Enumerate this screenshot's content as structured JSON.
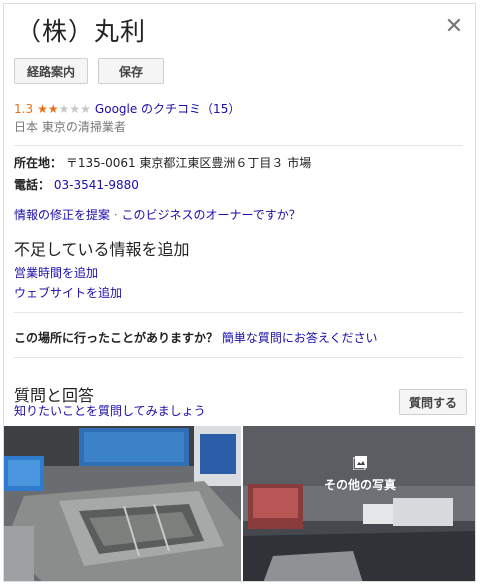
{
  "business": {
    "name": "（株）丸利",
    "rating": "1.3",
    "reviews_link": "Google のクチコミ（15）",
    "category": "日本 東京の清掃業者"
  },
  "actions": {
    "directions_label": "経路案内",
    "save_label": "保存"
  },
  "details": {
    "address_label": "所在地：",
    "address_value": "〒135-0061 東京都江東区豊洲６丁目３ 市場",
    "phone_label": "電話：",
    "phone_value": "03-3541-9880"
  },
  "links": {
    "suggest_edit": "情報の修正を提案",
    "separator": " · ",
    "own_business": "このビジネスのオーナーですか？"
  },
  "missing_info": {
    "title": "不足している情報を追加",
    "add_hours": "営業時間を追加",
    "add_website": "ウェブサイトを追加"
  },
  "visit": {
    "question": "この場所に行ったことがありますか？",
    "answer_link": "簡単な質問にお答えください"
  },
  "qa": {
    "title": "質問と回答",
    "subtitle": "知りたいことを質問してみましょう",
    "ask_label": "質問する"
  },
  "photos": {
    "more_label": "その他の写真"
  },
  "colors": {
    "link": "#1a0dab",
    "star": "#e7711b",
    "text": "#222222",
    "muted": "#777777"
  },
  "icons": [
    "close-icon",
    "star-icon",
    "photo-icon"
  ]
}
